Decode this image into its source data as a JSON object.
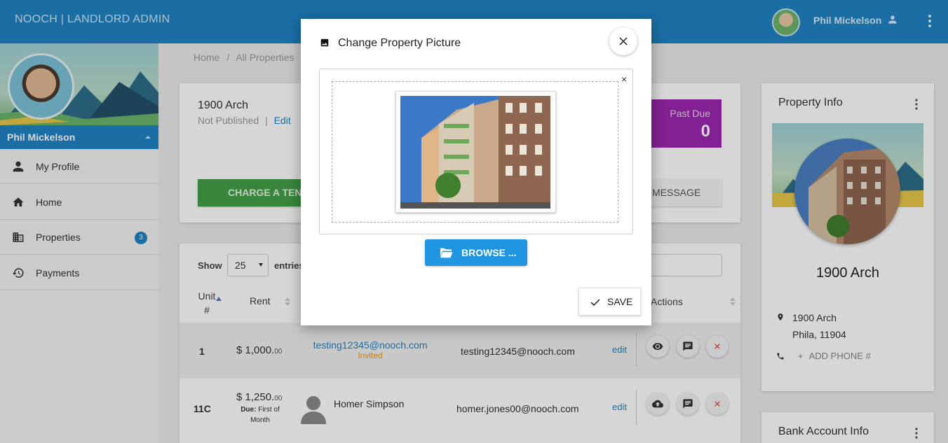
{
  "topbar": {
    "brand": "NOOCH | LANDLORD ADMIN",
    "user_name": "Phil Mickelson"
  },
  "sidebar": {
    "user_name": "Phil Mickelson",
    "items": [
      {
        "label": "My Profile",
        "icon": "person-icon"
      },
      {
        "label": "Home",
        "icon": "home-icon"
      },
      {
        "label": "Properties",
        "icon": "building-icon",
        "badge": "3"
      },
      {
        "label": "Payments",
        "icon": "history-icon"
      }
    ]
  },
  "breadcrumb": {
    "home": "Home",
    "sep": "/",
    "current": "All Properties"
  },
  "property": {
    "name": "1900 Arch",
    "status": "Not Published",
    "status_sep": "|",
    "edit_label": "Edit",
    "past_due_label": "Past Due",
    "past_due_value": "0",
    "charge_button": "CHARGE A TENANT",
    "message_button": "MESSAGE"
  },
  "table": {
    "show_label": "Show",
    "page_size": "25",
    "entries_label": "entries",
    "columns": {
      "unit": "Unit #",
      "rent": "Rent",
      "actions": "Actions"
    },
    "rows": [
      {
        "unit": "1",
        "rent_main": "$ 1,000.",
        "rent_cents": "00",
        "tenant_link": "testing12345@nooch.com",
        "tenant_status": "Invited",
        "email": "testing12345@nooch.com",
        "edit": "edit"
      },
      {
        "unit": "11C",
        "rent_main": "$ 1,250.",
        "rent_cents": "00",
        "due_label": "Due:",
        "due_value": "First of Month",
        "tenant_name": "Homer Simpson",
        "email": "homer.jones00@nooch.com",
        "edit": "edit"
      }
    ]
  },
  "property_info": {
    "title": "Property Info",
    "name": "1900 Arch",
    "address_line1": "1900 Arch",
    "address_line2": "Phila, 11904",
    "phone_add": "ADD PHONE #",
    "bank_title": "Bank Account Info"
  },
  "modal": {
    "title": "Change Property Picture",
    "browse_label": "BROWSE ...",
    "save_label": "SAVE",
    "remove_label": "×"
  },
  "colors": {
    "primary": "#1f84c4",
    "charge_green": "#43a047",
    "past_due_purple": "#9c27b0",
    "invited_orange": "#e89a17"
  }
}
